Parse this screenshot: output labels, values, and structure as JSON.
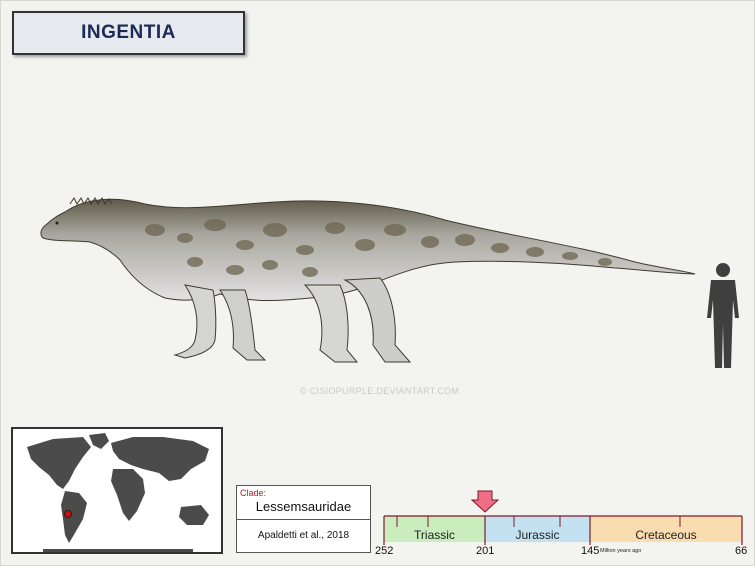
{
  "title": "INGENTIA",
  "watermark": "© CISIOPURPLE.DEVIANTART.COM",
  "clade": {
    "label": "Clade:",
    "name": "Lessemsauridae",
    "citation": "Apaldetti et al., 2018"
  },
  "timeline": {
    "periods": [
      {
        "name": "Triassic",
        "color": "#c9edbd"
      },
      {
        "name": "Jurassic",
        "color": "#c4e1f2"
      },
      {
        "name": "Cretaceous",
        "color": "#f9dcb0"
      }
    ],
    "ticks": [
      "252",
      "201",
      "145",
      "66"
    ],
    "unit": "Million years ago",
    "marker_mya": 201,
    "marker_color": "#ef6e86"
  },
  "map": {
    "location_marker_color": "#c0141a"
  },
  "icons": {
    "dinosaur": "dinosaur-silhouette-icon",
    "human": "human-scale-icon",
    "arrow": "down-arrow-icon"
  }
}
